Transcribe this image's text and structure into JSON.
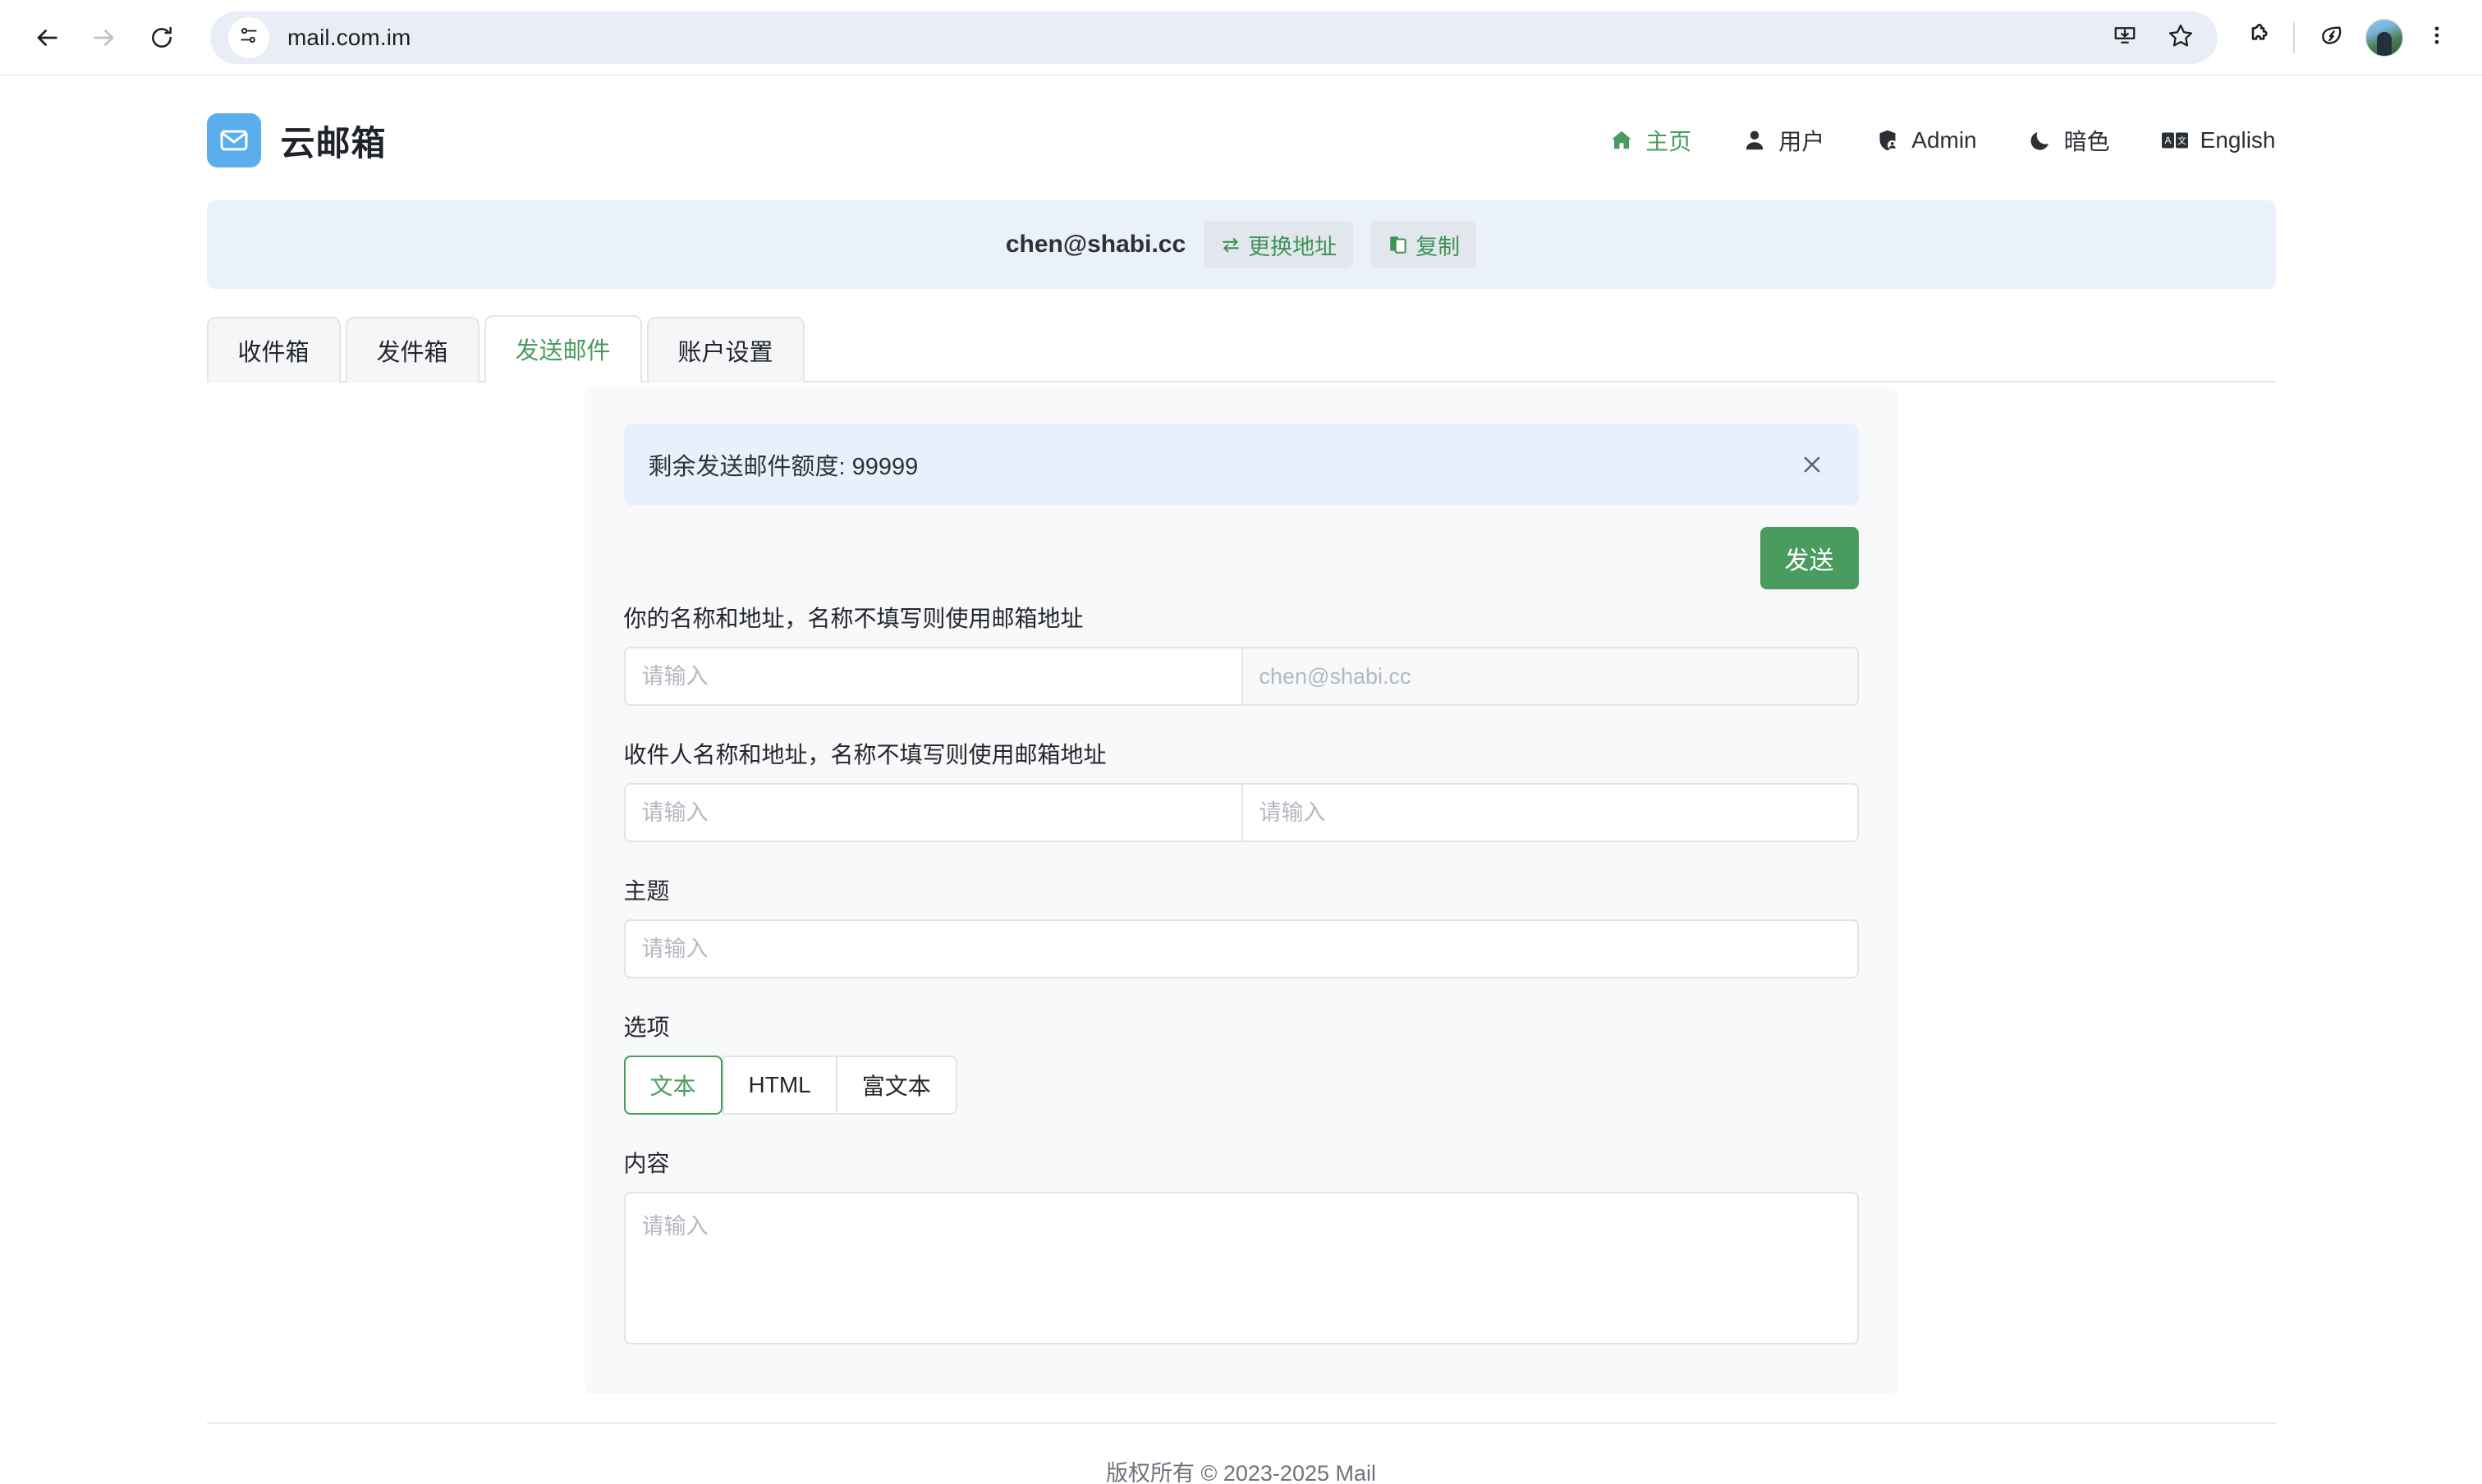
{
  "browser": {
    "url": "mail.com.im",
    "back_icon": "back-arrow-icon",
    "forward_icon": "forward-arrow-icon",
    "reload_icon": "reload-icon",
    "site_info_icon": "site-settings-icon",
    "install_icon": "install-app-icon",
    "bookmark_icon": "star-bookmark-icon",
    "extensions_icon": "extensions-puzzle-icon",
    "performance_icon": "performance-leaf-icon",
    "profile_icon": "profile-avatar-icon",
    "menu_icon": "three-dot-menu-icon"
  },
  "app": {
    "brand": "云邮箱",
    "nav": [
      {
        "label": "主页",
        "icon": "home-icon",
        "active": true
      },
      {
        "label": "用户",
        "icon": "user-icon",
        "active": false
      },
      {
        "label": "Admin",
        "icon": "shield-user-icon",
        "active": false
      },
      {
        "label": "暗色",
        "icon": "moon-icon",
        "active": false
      },
      {
        "label": "English",
        "icon": "translate-icon",
        "active": false
      }
    ]
  },
  "address_banner": {
    "email": "chen@shabi.cc",
    "change_label": "更换地址",
    "change_icon": "swap-arrows-icon",
    "copy_label": "复制",
    "copy_icon": "clipboard-copy-icon"
  },
  "tabs": [
    {
      "label": "收件箱",
      "active": false
    },
    {
      "label": "发件箱",
      "active": false
    },
    {
      "label": "发送邮件",
      "active": true
    },
    {
      "label": "账户设置",
      "active": false
    }
  ],
  "compose": {
    "alert_text": "剩余发送邮件额度: 99999",
    "alert_close_icon": "close-x-icon",
    "send_label": "发送",
    "sender": {
      "label": "你的名称和地址，名称不填写则使用邮箱地址",
      "name_value": "",
      "name_placeholder": "请输入",
      "address_value": "",
      "address_placeholder": "chen@shabi.cc"
    },
    "recipient": {
      "label": "收件人名称和地址，名称不填写则使用邮箱地址",
      "name_value": "",
      "name_placeholder": "请输入",
      "address_value": "",
      "address_placeholder": "请输入"
    },
    "subject": {
      "label": "主题",
      "value": "",
      "placeholder": "请输入"
    },
    "options": {
      "label": "选项",
      "items": [
        {
          "label": "文本",
          "active": true
        },
        {
          "label": "HTML",
          "active": false
        },
        {
          "label": "富文本",
          "active": false
        }
      ]
    },
    "content": {
      "label": "内容",
      "value": "",
      "placeholder": "请输入"
    }
  },
  "footer": {
    "text": "版权所有 © 2023-2025   Mail"
  },
  "colors": {
    "accent_green": "#4a9b5e",
    "brand_blue": "#5aaeec",
    "alert_blue": "#e8f0fb",
    "banner_blue": "#eaf1fb",
    "card_grey": "#f8f9fa"
  }
}
